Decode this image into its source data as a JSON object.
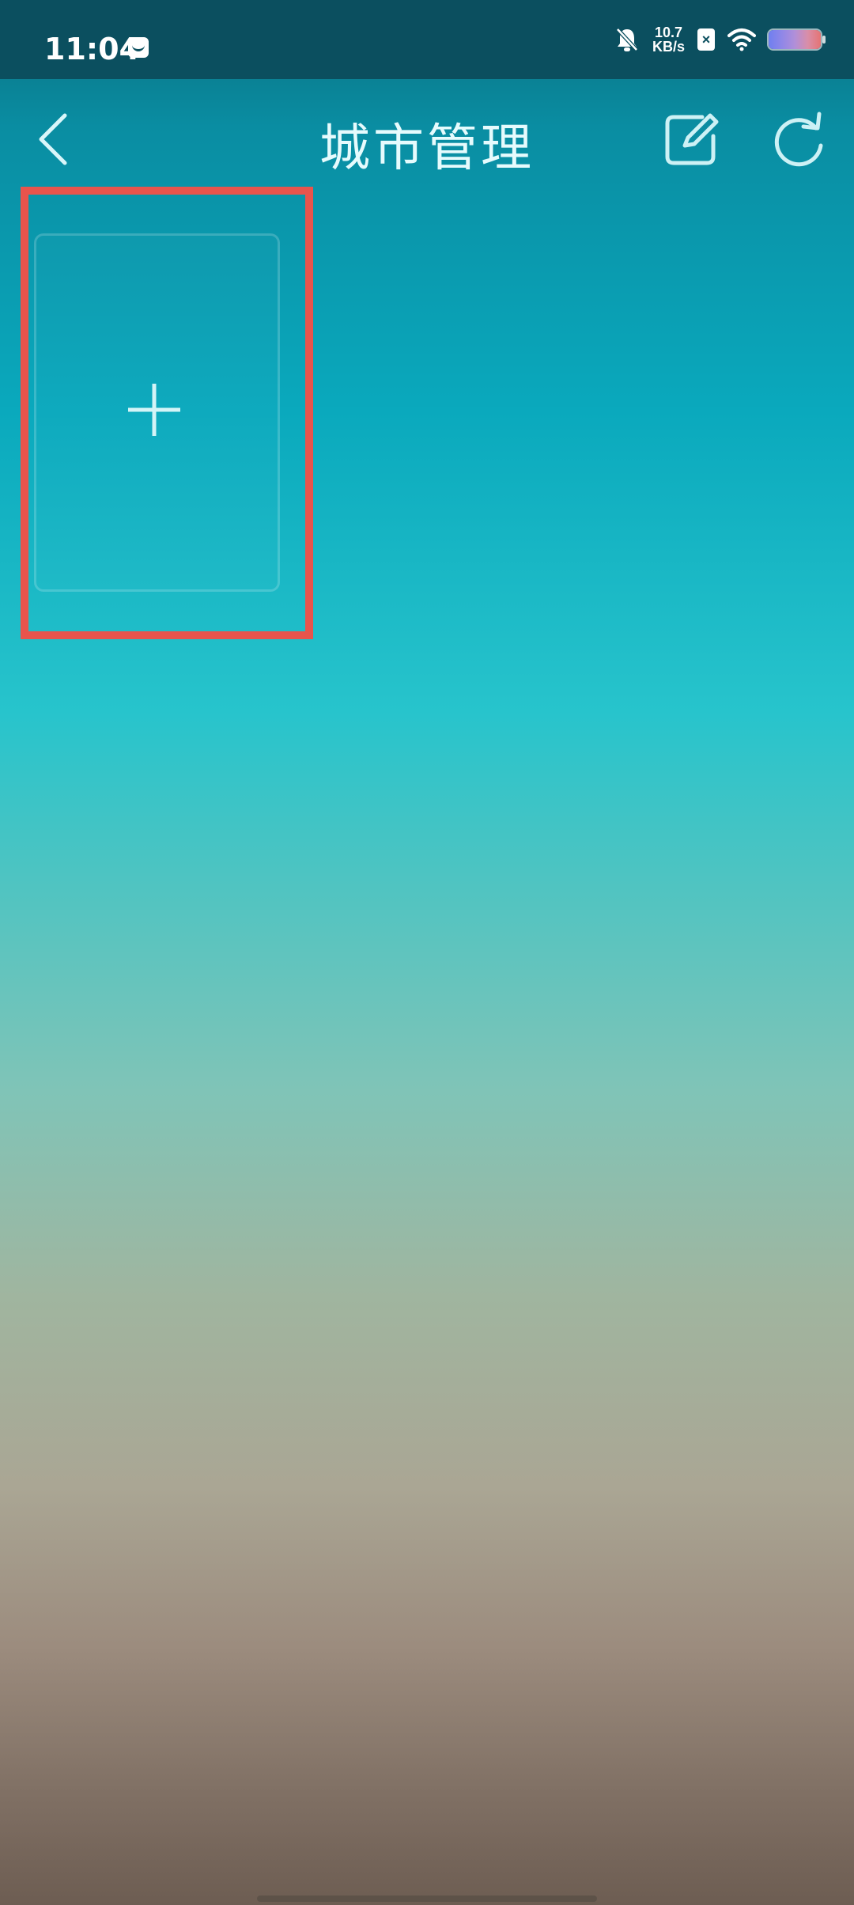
{
  "status_bar": {
    "time": "11:04",
    "net_speed_value": "10.7",
    "net_speed_unit": "KB/s",
    "icons": [
      "notification-icon",
      "bell-mute-icon",
      "sim-x-icon",
      "wifi-icon",
      "battery-icon"
    ]
  },
  "header": {
    "title": "城市管理",
    "back_icon": "chevron-left-icon",
    "edit_icon": "edit-icon",
    "refresh_icon": "refresh-icon"
  },
  "main": {
    "add_card_icon": "plus-icon"
  },
  "colors": {
    "highlight_border": "#e8544c",
    "status_bar_bg": "#0b4f5f"
  }
}
